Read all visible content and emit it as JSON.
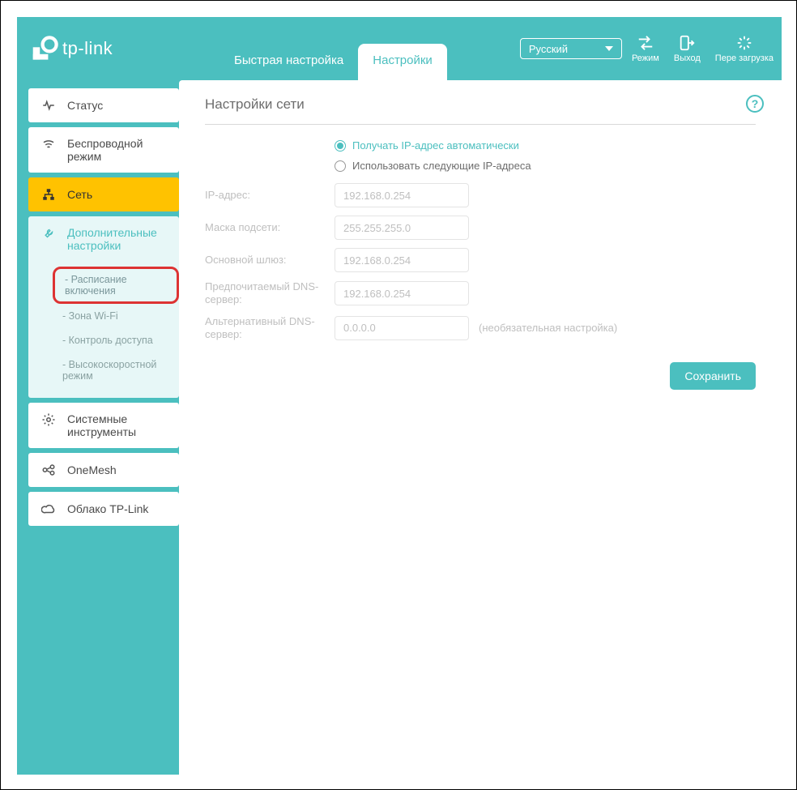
{
  "brand": "tp-link",
  "tabs": {
    "quick": "Быстрая настройка",
    "settings": "Настройки"
  },
  "language": "Русский",
  "topbar": {
    "mode": "Режим",
    "logout": "Выход",
    "reload": "Пере загрузка"
  },
  "sidebar": {
    "status": "Статус",
    "wireless": "Беспроводной режим",
    "network": "Сеть",
    "advanced": "Дополнительные настройки",
    "subs": {
      "schedule": "Расписание включения",
      "wifi_zone": "Зона Wi-Fi",
      "access_control": "Контроль доступа",
      "highspeed": "Высокоскоростной режим"
    },
    "system_tools": "Системные инструменты",
    "onemesh": "OneMesh",
    "cloud": "Облако TP-Link"
  },
  "page_title": "Настройки сети",
  "radios": {
    "auto": "Получать IP-адрес автоматически",
    "manual": "Использовать следующие IP-адреса"
  },
  "fields": {
    "ip_label": "IP-адрес:",
    "ip_value": "192.168.0.254",
    "mask_label": "Маска подсети:",
    "mask_value": "255.255.255.0",
    "gw_label": "Основной шлюз:",
    "gw_value": "192.168.0.254",
    "dns1_label": "Предпочитаемый DNS-сервер:",
    "dns1_value": "192.168.0.254",
    "dns2_label": "Альтернативный DNS-сервер:",
    "dns2_value": "0.0.0.0",
    "dns2_hint": "(необязательная настройка)"
  },
  "save": "Сохранить"
}
